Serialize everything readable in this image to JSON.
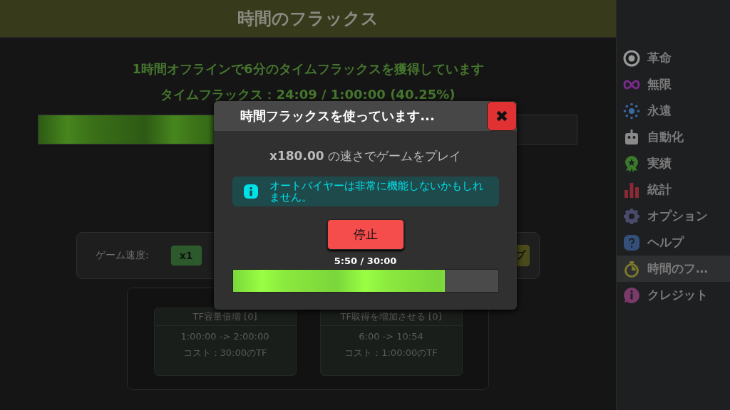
{
  "header": {
    "title": "時間のフラックス"
  },
  "main": {
    "gain_text": "1時間オフラインで6分のタイムフラックスを獲得しています",
    "flux_text": "タイムフラックス：24:09 / 1:00:00 (40.25%)",
    "flux_bar": {
      "level": 0.4025
    },
    "speed_panel": {
      "label": "ゲーム速度:",
      "buttons": [
        {
          "label": "x1",
          "kind": "green"
        },
        {
          "label": "プ",
          "kind": "yellow"
        }
      ]
    },
    "upgrades": [
      {
        "title": "TF容量倍増 [0]",
        "effect": "1:00:00 -> 2:00:00",
        "cost": "コスト：30:00のTF"
      },
      {
        "title": "TF取得を増加させる [0]",
        "effect": "6:00 -> 10:54",
        "cost": "コスト：1:00:00のTF"
      }
    ]
  },
  "sidebar": {
    "items": [
      {
        "label": "革命",
        "kind": "ring",
        "color": "#9a9a9a",
        "selected": false
      },
      {
        "label": "無限",
        "kind": "infinity",
        "color": "#7a2a8a",
        "selected": false
      },
      {
        "label": "永遠",
        "kind": "dots",
        "color": "#3a6aa0",
        "selected": false
      },
      {
        "label": "自動化",
        "kind": "robot",
        "color": "#8a8a8a",
        "selected": false
      },
      {
        "label": "実績",
        "kind": "medal",
        "color": "#3a7a2a",
        "selected": false
      },
      {
        "label": "統計",
        "kind": "bars",
        "color": "#8a2a35",
        "selected": false
      },
      {
        "label": "オプション",
        "kind": "gear",
        "color": "#4a4a6a",
        "selected": false
      },
      {
        "label": "ヘルプ",
        "kind": "help",
        "color": "#34507a",
        "selected": false
      },
      {
        "label": "時間のフ…",
        "kind": "timer",
        "color": "#7a7a2a",
        "selected": true
      },
      {
        "label": "クレジット",
        "kind": "info",
        "color": "#7a3a6a",
        "selected": false
      }
    ]
  },
  "modal": {
    "title": "時間フラックスを使っています...",
    "close": "✖",
    "speed_text": "**x180.00** の速さでゲームをプレイ",
    "info": "オートバイヤーは非常に機能しないかもしれません。",
    "stop_button": "停止",
    "reading": "5:50 / 30:00",
    "bar": {
      "level": 0.8
    }
  }
}
